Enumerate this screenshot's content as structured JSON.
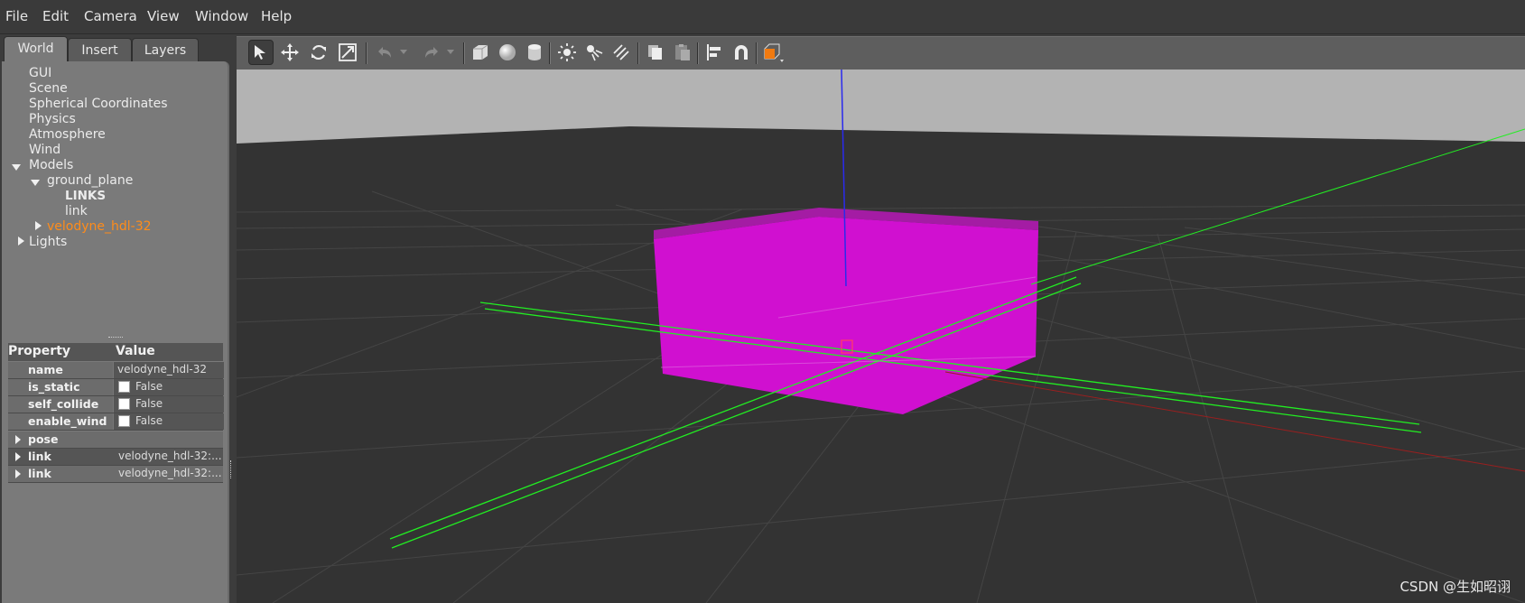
{
  "menubar": {
    "items": [
      "File",
      "Edit",
      "Camera",
      "View",
      "Window",
      "Help"
    ]
  },
  "tabs": [
    "World",
    "Insert",
    "Layers"
  ],
  "world_tree": {
    "items": [
      "GUI",
      "Scene",
      "Spherical Coordinates",
      "Physics",
      "Atmosphere",
      "Wind"
    ],
    "models_label": "Models",
    "ground_plane": "ground_plane",
    "links_label": "LINKS",
    "link_label": "link",
    "selected_model": "velodyne_hdl-32",
    "lights_label": "Lights",
    "selected_color": "#ff8c1a"
  },
  "properties": {
    "header_property": "Property",
    "header_value": "Value",
    "rows": [
      {
        "name": "name",
        "value": "velodyne_hdl-32"
      },
      {
        "name": "is_static",
        "value": "False"
      },
      {
        "name": "self_collide",
        "value": "False"
      },
      {
        "name": "enable_wind",
        "value": "False"
      },
      {
        "name": "pose",
        "value": ""
      },
      {
        "name": "link",
        "value": "velodyne_hdl-32:..."
      },
      {
        "name": "link",
        "value": "velodyne_hdl-32:..."
      }
    ]
  },
  "toolbar": {
    "tools": [
      "select-arrow-icon",
      "translate-icon",
      "rotate-icon",
      "scale-icon",
      "undo-icon",
      "undo-history-icon",
      "redo-icon",
      "redo-history-icon",
      "box-shape-icon",
      "sphere-shape-icon",
      "cylinder-shape-icon",
      "point-light-icon",
      "spot-light-icon",
      "directional-light-icon",
      "copy-icon",
      "paste-icon",
      "align-icon",
      "snap-magnet-icon",
      "view-angle-icon"
    ]
  },
  "scene": {
    "model_color": "#d010d0",
    "axis_colors": {
      "x": "#cc2020",
      "y": "#22dd22",
      "z": "#2222ee"
    }
  },
  "watermark": "CSDN @生如昭诩"
}
